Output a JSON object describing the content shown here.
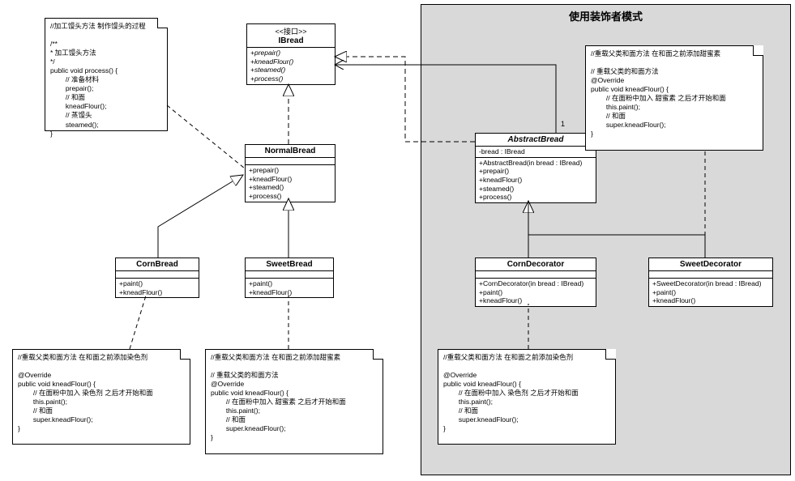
{
  "region_title": "使用装饰者模式",
  "ibread": {
    "stereotype": "<<接口>>",
    "name": "IBread",
    "ops": [
      "+prepair()",
      "+kneadFlour()",
      "+steamed()",
      "+process()"
    ]
  },
  "normalbread": {
    "name": "NormalBread",
    "ops": [
      "+prepair()",
      "+kneadFlour()",
      "+steamed()",
      "+process()"
    ]
  },
  "cornbread": {
    "name": "CornBread",
    "ops": [
      "+paint()",
      "+kneadFlour()"
    ]
  },
  "sweetbread": {
    "name": "SweetBread",
    "ops": [
      "+paint()",
      "+kneadFlour()"
    ]
  },
  "abstractbread": {
    "name": "AbstractBread",
    "attrs": [
      "-bread : IBread"
    ],
    "ops": [
      "+AbstractBread(in bread : IBread)",
      "+prepair()",
      "+kneadFlour()",
      "+steamed()",
      "+process()"
    ]
  },
  "corndecorator": {
    "name": "CornDecorator",
    "ops": [
      "+CornDecorator(in bread : IBread)",
      "+paint()",
      "+kneadFlour()"
    ]
  },
  "sweetdecorator": {
    "name": "SweetDecorator",
    "ops": [
      "+SweetDecorator(in bread : IBread)",
      "+paint()",
      "+kneadFlour()"
    ]
  },
  "note_process": "//加工馒头方法 制作馒头的过程\n\n/**\n* 加工馒头方法\n*/\npublic void process() {\n        // 准备材料\n        prepair();\n        // 和面\n        kneadFlour();\n        // 蒸馒头\n        steamed();\n}",
  "note_corn": "//重载父类和面方法 在和面之前添加染色剂\n\n@Override\npublic void kneadFlour() {\n        // 在面粉中加入 染色剂 之后才开始和面\n        this.paint();\n        // 和面\n        super.kneadFlour();\n}",
  "note_sweet": "//重载父类和面方法 在和面之前添加甜蜜素\n\n// 重载父类的和面方法\n@Override\npublic void kneadFlour() {\n        // 在面粉中加入 甜蜜素 之后才开始和面\n        this.paint();\n        // 和面\n        super.kneadFlour();\n}",
  "note_corn_dec": "//重载父类和面方法 在和面之前添加染色剂\n\n@Override\npublic void kneadFlour() {\n        // 在面粉中加入 染色剂 之后才开始和面\n        this.paint();\n        // 和面\n        super.kneadFlour();\n}",
  "note_sweet_dec": "//重载父类和面方法 在和面之前添加甜蜜素\n\n// 重载父类的和面方法\n@Override\npublic void kneadFlour() {\n        // 在面粉中加入 甜蜜素 之后才开始和面\n        this.paint();\n        // 和面\n        super.kneadFlour();\n}",
  "mult_one": "1"
}
